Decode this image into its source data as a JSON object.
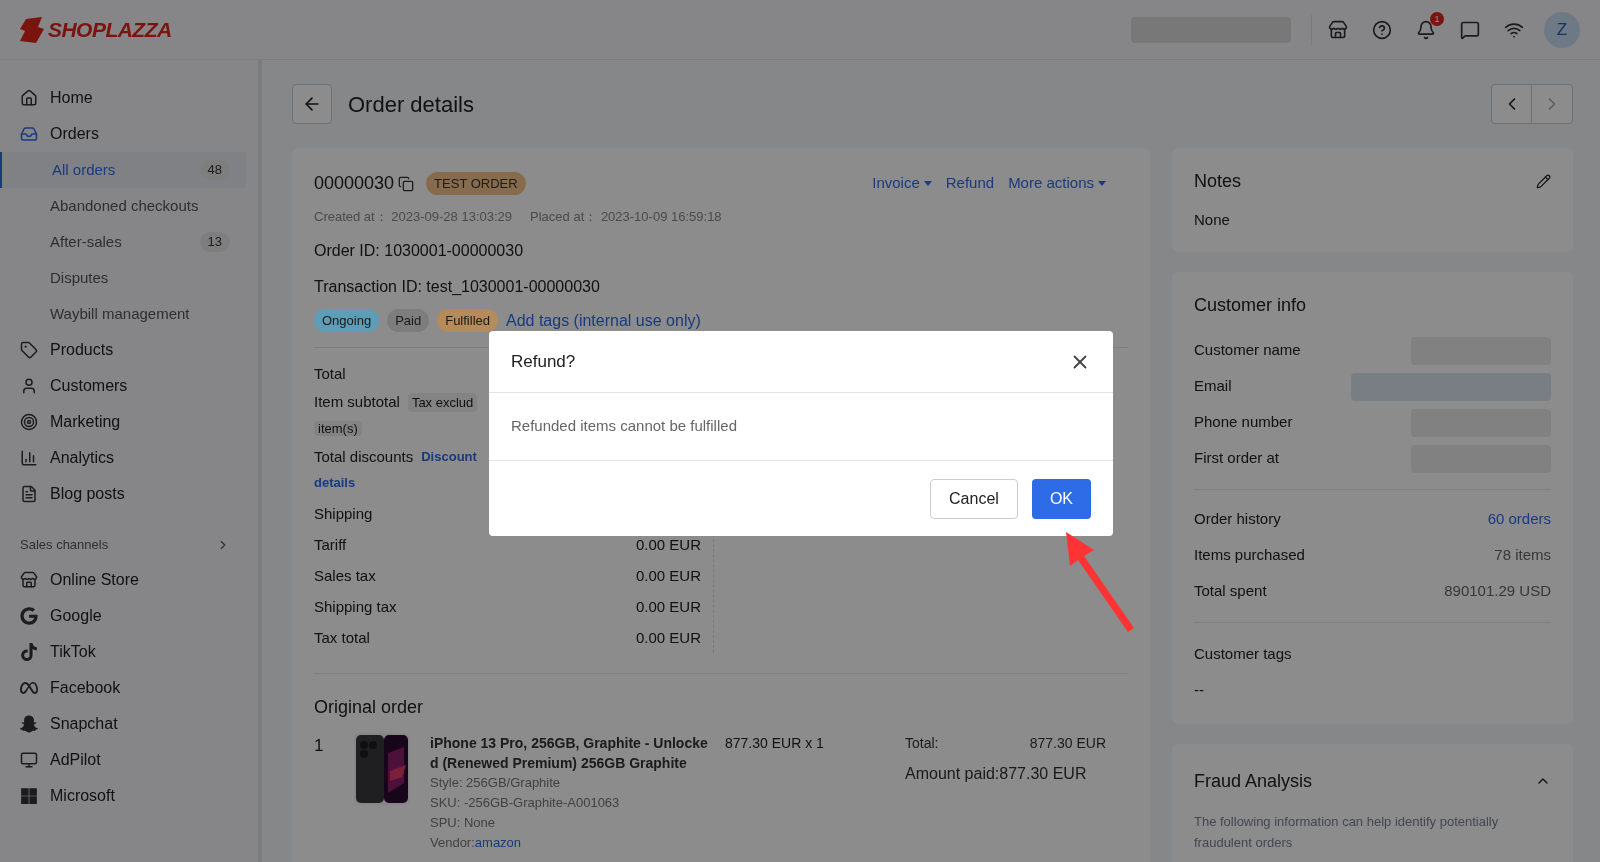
{
  "header": {
    "logo": "SHOPLAZZA",
    "notification_count": "1",
    "avatar": "Z"
  },
  "sidebar": {
    "items": [
      {
        "label": "Home",
        "selected": false
      },
      {
        "label": "Orders",
        "selected": false,
        "children": [
          {
            "label": "All orders",
            "badge": "48",
            "selected": true
          },
          {
            "label": "Abandoned checkouts",
            "selected": false
          },
          {
            "label": "After-sales",
            "badge": "13",
            "selected": false
          },
          {
            "label": "Disputes",
            "selected": false
          },
          {
            "label": "Waybill management",
            "selected": false
          }
        ]
      },
      {
        "label": "Products",
        "selected": false
      },
      {
        "label": "Customers",
        "selected": false
      },
      {
        "label": "Marketing",
        "selected": false
      },
      {
        "label": "Analytics",
        "selected": false
      },
      {
        "label": "Blog posts",
        "selected": false
      }
    ],
    "section": "Sales channels",
    "channels": [
      {
        "label": "Online Store",
        "selected": false
      },
      {
        "label": "Google",
        "selected": false
      },
      {
        "label": "TikTok",
        "selected": false
      },
      {
        "label": "Facebook",
        "selected": false
      },
      {
        "label": "Snapchat",
        "selected": false
      },
      {
        "label": "AdPilot",
        "selected": false
      },
      {
        "label": "Microsoft",
        "selected": false
      }
    ]
  },
  "page": {
    "title": "Order details"
  },
  "order": {
    "number": "00000030",
    "tag": "TEST ORDER",
    "actions": [
      {
        "label": "Invoice",
        "dropdown": true
      },
      {
        "label": "Refund",
        "dropdown": false
      },
      {
        "label": "More actions",
        "dropdown": true
      }
    ],
    "created_label": "Created at：",
    "created": "2023-09-28 13:03:29",
    "placed_label": "Placed at：",
    "placed": "2023-10-09 16:59:18",
    "order_id": "Order ID: 1030001-00000030",
    "transaction_id": "Transaction ID: test_1030001-00000030",
    "status_tags": [
      {
        "label": "Ongoing",
        "color": "#5e9db6"
      },
      {
        "label": "Paid",
        "color": "#7d7d7d"
      },
      {
        "label": "Fulfilled",
        "color": "#b58b5c"
      }
    ],
    "add_tags": "Add tags (internal use only)"
  },
  "totals": {
    "title": "Total",
    "subtotal_label": "Item subtotal",
    "subtotal_tag": "Tax exclud",
    "subtotal_items": "item(s)",
    "discounts_label": "Total discounts",
    "discounts_link": "Discount",
    "discounts_link_2": "details",
    "shipping_label": "Shipping",
    "rows": [
      {
        "label": "Tariff",
        "value": "0.00 EUR"
      },
      {
        "label": "Sales tax",
        "value": "0.00 EUR"
      },
      {
        "label": "Shipping tax",
        "value": "0.00 EUR"
      },
      {
        "label": "Tax total",
        "value": "0.00 EUR"
      }
    ]
  },
  "original_order": {
    "title": "Original order",
    "items": [
      {
        "index": "1",
        "name": "iPhone 13 Pro, 256GB, Graphite - Unlocked (Renewed Premium) 256GB Graphite",
        "style": "Style: 256GB/Graphite",
        "sku": "SKU: -256GB-Graphite-A001063",
        "spu": "SPU: None",
        "vendor_label": "Vendor:",
        "vendor": "amazon",
        "price": "877.30 EUR x 1",
        "total_label": "Total:",
        "total": "877.30 EUR",
        "paid": "Amount paid:877.30 EUR"
      }
    ]
  },
  "notes": {
    "title": "Notes",
    "text": "None"
  },
  "customer_info": {
    "title": "Customer info",
    "fields": [
      "Customer name",
      "Email",
      "Phone number",
      "First order at"
    ],
    "stats": [
      {
        "label": "Order history",
        "value": "60 orders",
        "link": true
      },
      {
        "label": "Items purchased",
        "value": "78 items",
        "link": false
      },
      {
        "label": "Total spent",
        "value": "890101.29 USD",
        "link": false
      }
    ],
    "tags_label": "Customer tags",
    "tags": "--"
  },
  "fraud": {
    "title": "Fraud Analysis",
    "expanded": true,
    "text": "The following information can help identify potentially fraudulent orders"
  },
  "dialog": {
    "title": "Refund?",
    "message": "Refunded items cannot be fulfilled",
    "buttons": [
      {
        "label": "Cancel",
        "kind": "secondary"
      },
      {
        "label": "OK",
        "kind": "primary"
      }
    ]
  }
}
